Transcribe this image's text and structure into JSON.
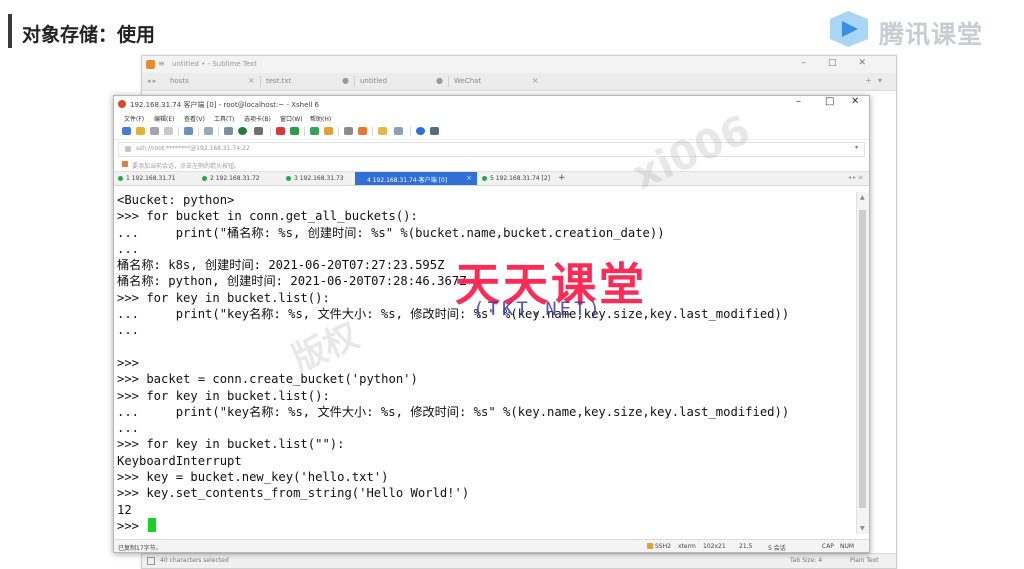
{
  "slide": {
    "title": "对象存储：使用",
    "logo_text": "腾讯课堂"
  },
  "sublime": {
    "window_title": "untitled • - Sublime Text",
    "tabs": [
      {
        "label": "hosts"
      },
      {
        "label": "test.txt"
      },
      {
        "label": "untitled"
      },
      {
        "label": "WeChat"
      }
    ],
    "status_left": "40 characters selected",
    "status_tab_size": "Tab Size: 4",
    "status_syntax": "Plain Text"
  },
  "xshell": {
    "window_title": "192.168.31.74 客户端 [0] - root@localhost:~ - Xshell 6",
    "menus": [
      "文件(F)",
      "编辑(E)",
      "查看(V)",
      "工具(T)",
      "选项卡(B)",
      "窗口(W)",
      "帮助(H)"
    ],
    "address": "ssh://root:********@192.168.31.74:22",
    "hint": "要添加当前会话，点击左侧的箭头按钮。",
    "tabs": [
      {
        "label": "1 192.168.31.71",
        "active": false
      },
      {
        "label": "2 192.168.31.72",
        "active": false
      },
      {
        "label": "3 192.168.31.73",
        "active": false
      },
      {
        "label": "4 192.168.31.74-客户端 [0]",
        "active": true
      },
      {
        "label": "5 192.168.31.74 [2]",
        "active": false
      }
    ],
    "terminal_lines": [
      "<Bucket: python>",
      ">>> for bucket in conn.get_all_buckets():",
      "...     print(\"桶名称: %s, 创建时间: %s\" %(bucket.name,bucket.creation_date))",
      "...",
      "桶名称: k8s, 创建时间: 2021-06-20T07:27:23.595Z",
      "桶名称: python, 创建时间: 2021-06-20T07:28:46.367Z",
      ">>> for key in bucket.list():",
      "...     print(\"key名称: %s, 文件大小: %s, 修改时间: %s\" %(key.name,key.size,key.last_modified))",
      "...",
      "",
      ">>>",
      ">>> backet = conn.create_bucket('python')",
      ">>> for key in bucket.list():",
      "...     print(\"key名称: %s, 文件大小: %s, 修改时间: %s\" %(key.name,key.size,key.last_modified))",
      "...",
      ">>> for key in bucket.list(\"\"):",
      "KeyboardInterrupt",
      ">>> key = bucket.new_key('hello.txt')",
      ">>> key.set_contents_from_string('Hello World!')",
      "12",
      ">>> "
    ],
    "status": {
      "left": "已复制17字节。",
      "protocol": "SSH2",
      "term": "xterm",
      "size": "102x21",
      "pos": "21,5",
      "sessions": "5 会话",
      "caps": "CAP",
      "num": "NUM"
    }
  },
  "watermarks": {
    "logo_main": "天天课堂",
    "logo_sub": "(TKT.NET)",
    "diagonal": "xi006",
    "diagonal2": "版权"
  }
}
